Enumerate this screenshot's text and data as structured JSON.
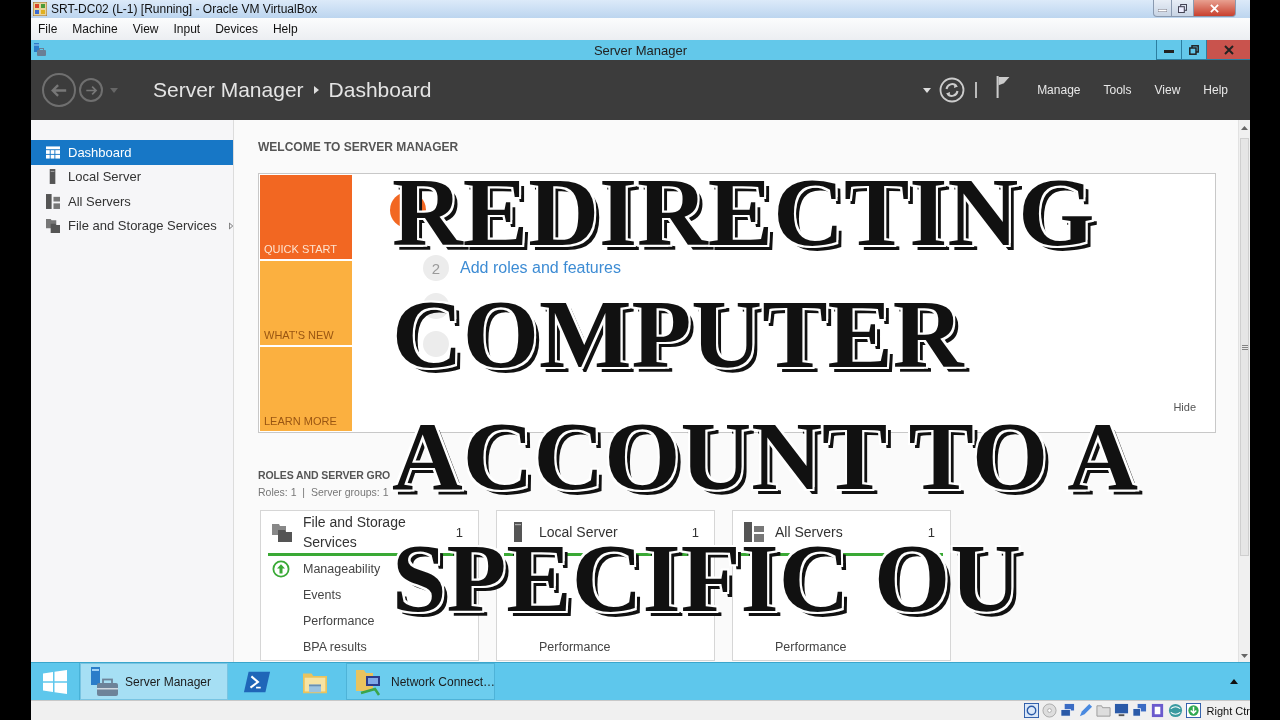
{
  "vbox_window": {
    "title": "SRT-DC02 (L-1) [Running] - Oracle VM VirtualBox",
    "menu": [
      "File",
      "Machine",
      "View",
      "Input",
      "Devices",
      "Help"
    ]
  },
  "app_window": {
    "title": "Server Manager"
  },
  "header": {
    "breadcrumb": [
      "Server Manager",
      "Dashboard"
    ],
    "menu": [
      "Manage",
      "Tools",
      "View",
      "Help"
    ]
  },
  "sidebar": {
    "items": [
      {
        "label": "Dashboard",
        "selected": true,
        "has_submenu": false
      },
      {
        "label": "Local Server",
        "selected": false,
        "has_submenu": false
      },
      {
        "label": "All Servers",
        "selected": false,
        "has_submenu": false
      },
      {
        "label": "File and Storage Services",
        "selected": false,
        "has_submenu": true
      }
    ]
  },
  "welcome": {
    "heading": "WELCOME TO SERVER MANAGER",
    "tiles": [
      {
        "label": "QUICK START",
        "selected": true
      },
      {
        "label": "WHAT'S NEW",
        "selected": false
      },
      {
        "label": "LEARN MORE",
        "selected": false
      }
    ],
    "steps": [
      {
        "active": true
      },
      {
        "number": "2",
        "label": "Add roles and features",
        "active": false
      },
      {
        "active": false
      },
      {
        "active": false
      }
    ],
    "hide_link": "Hide"
  },
  "roles": {
    "heading": "ROLES AND SERVER GRO",
    "summary": "Roles: 1  |  Server groups: 1",
    "cards": [
      {
        "title": "File and Storage Services",
        "count": "1",
        "healthy": true,
        "rows": [
          {
            "label": "Manageability",
            "kind": "status"
          },
          {
            "label": "Events",
            "kind": "plain"
          },
          {
            "label": "Performance",
            "kind": "plain"
          },
          {
            "label": "BPA results",
            "kind": "plain"
          }
        ]
      },
      {
        "title": "Local Server",
        "count": "1",
        "healthy": true,
        "rows": [
          {
            "label": "Performance",
            "kind": "plain"
          }
        ]
      },
      {
        "title": "All Servers",
        "count": "1",
        "healthy": true,
        "rows": [
          {
            "label": "Performance",
            "kind": "plain"
          }
        ]
      }
    ]
  },
  "overlay_title": [
    "REDIRECTING",
    "COMPUTER",
    "ACCOUNT TO A",
    "SPECIFIC OU"
  ],
  "taskbar": {
    "buttons": [
      {
        "label": "Server Manager",
        "selected": true
      },
      {
        "label": "Network Connect…",
        "selected": false
      }
    ]
  },
  "status_bar": {
    "host_key": "Right Ctr"
  }
}
